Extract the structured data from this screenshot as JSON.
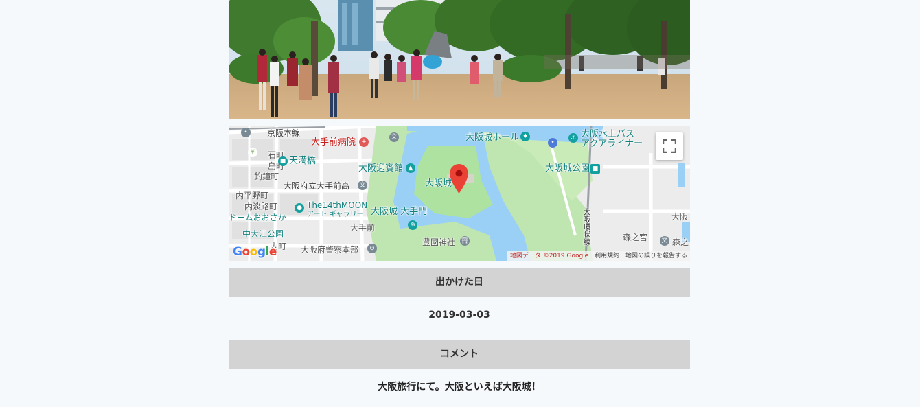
{
  "map": {
    "labels": {
      "keihan": "京阪本線",
      "hospital": "大手前病院",
      "ishimachi": "石町",
      "shimamachi": "島町",
      "tenmabashi": "天満橋",
      "tsurigane": "釣鐘町",
      "geihinkan": "大阪迎賓館",
      "osakajo": "大阪城",
      "hall": "大阪城ホール",
      "waterbus": "大阪水上バス",
      "aqualiner": "アクアライナー",
      "park_station": "大阪城公園",
      "highschool": "大阪府立大手前高",
      "uchihirano": "内平野町",
      "uchiawaji": "内淡路町",
      "dome": "ドームおおさか",
      "moon_name": "The14thMOON",
      "moon_desc": "アート ギャラリー",
      "otemon": "大阪城 大手門",
      "otemae": "大手前",
      "nakaoe": "中大江公園",
      "omotemachi": "内町",
      "police": "大阪府警察本部",
      "hokoku": "豊國神社",
      "loop_line": "大阪環状線",
      "morinomiya": "森之宮",
      "morino": "森之",
      "osaka_edge": "大阪"
    },
    "google_logo": "Google",
    "attribution": {
      "map_data": "地図データ ©2019 Google",
      "terms": "利用規約",
      "report": "地図の誤りを報告する"
    },
    "fullscreen_icon": "fullscreen-icon",
    "marker_icon": "map-pin-icon"
  },
  "date_section": {
    "title": "出かけた日",
    "value": "2019-03-03"
  },
  "comment_section": {
    "title": "コメント",
    "value": "大阪旅行にて。大阪といえば大阪城！"
  }
}
